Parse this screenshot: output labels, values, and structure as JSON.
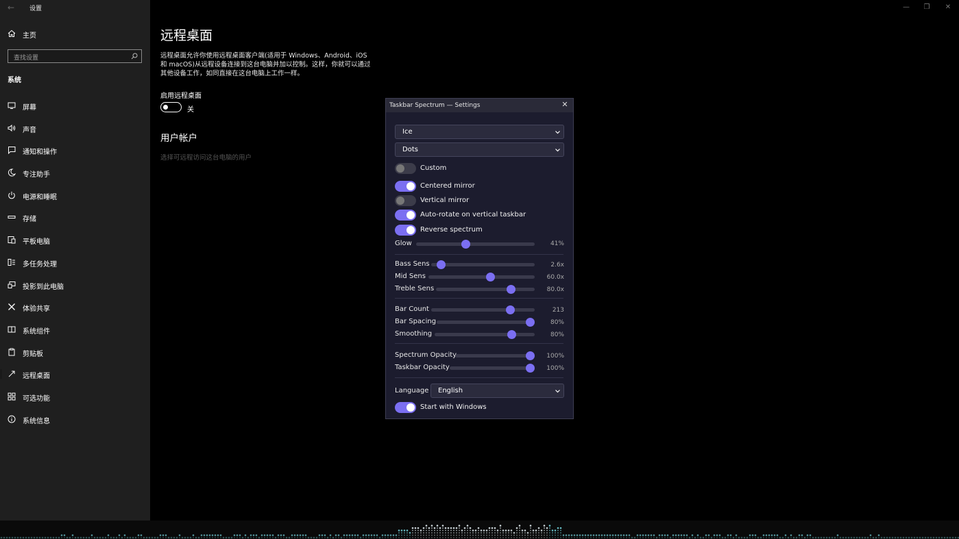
{
  "sidebar": {
    "app_title": "设置",
    "home_label": "主页",
    "search_placeholder": "查找设置",
    "section_label": "系统",
    "items": [
      {
        "label": "屏幕",
        "icon": "monitor-icon"
      },
      {
        "label": "声音",
        "icon": "speaker-icon"
      },
      {
        "label": "通知和操作",
        "icon": "notification-icon"
      },
      {
        "label": "专注助手",
        "icon": "moon-icon"
      },
      {
        "label": "电源和睡眠",
        "icon": "power-icon"
      },
      {
        "label": "存储",
        "icon": "storage-icon"
      },
      {
        "label": "平板电脑",
        "icon": "tablet-icon"
      },
      {
        "label": "多任务处理",
        "icon": "multitask-icon"
      },
      {
        "label": "投影到此电脑",
        "icon": "project-icon"
      },
      {
        "label": "体验共享",
        "icon": "share-icon"
      },
      {
        "label": "系统组件",
        "icon": "components-icon"
      },
      {
        "label": "剪贴板",
        "icon": "clipboard-icon"
      },
      {
        "label": "远程桌面",
        "icon": "remote-desktop-icon"
      },
      {
        "label": "可选功能",
        "icon": "optional-features-icon"
      },
      {
        "label": "系统信息",
        "icon": "info-icon"
      }
    ]
  },
  "main": {
    "page_title": "远程桌面",
    "description": "远程桌面允许你使用远程桌面客户端(适用于 Windows、Android、iOS 和 macOS)从远程设备连接到这台电脑并加以控制。这样，你就可以通过其他设备工作，如同直接在这台电脑上工作一样。",
    "enable_label": "启用远程桌面",
    "enable_state": "关",
    "enable_value": false,
    "accounts_title": "用户帐户",
    "accounts_link": "选择可远程访问这台电脑的用户"
  },
  "dialog": {
    "title": "Taskbar Spectrum — Settings",
    "close_glyph": "✕",
    "theme": {
      "value": "Ice"
    },
    "style": {
      "value": "Dots"
    },
    "toggles": [
      {
        "label": "Custom",
        "on": false
      },
      {
        "label": "Centered mirror",
        "on": true
      },
      {
        "label": "Vertical mirror",
        "on": false
      },
      {
        "label": "Auto-rotate on vertical taskbar",
        "on": true
      },
      {
        "label": "Reverse spectrum",
        "on": true
      }
    ],
    "sliders": [
      {
        "label": "Glow",
        "value_text": "41%",
        "fraction": 0.41
      },
      {
        "label": "Bass Sens",
        "value_text": "2.6x",
        "fraction": 0.06
      },
      {
        "label": "Mid Sens",
        "value_text": "60.0x",
        "fraction": 0.59
      },
      {
        "label": "Treble Sens",
        "value_text": "80.0x",
        "fraction": 0.79
      },
      {
        "label": "Bar Count",
        "value_text": "213",
        "fraction": 0.79
      },
      {
        "label": "Bar Spacing",
        "value_text": "80%",
        "fraction": 1.0
      },
      {
        "label": "Smoothing",
        "value_text": "80%",
        "fraction": 0.8
      },
      {
        "label": "Spectrum Opacity",
        "value_text": "100%",
        "fraction": 1.0
      },
      {
        "label": "Taskbar Opacity",
        "value_text": "100%",
        "fraction": 1.0
      }
    ],
    "language": {
      "label": "Language",
      "value": "English"
    },
    "start_with_windows": {
      "label": "Start with Windows",
      "on": true
    }
  },
  "colors": {
    "accent": "#7b6ff2",
    "dialog_bg": "#1c1c2e",
    "sidebar_bg": "#1f1f1f"
  }
}
